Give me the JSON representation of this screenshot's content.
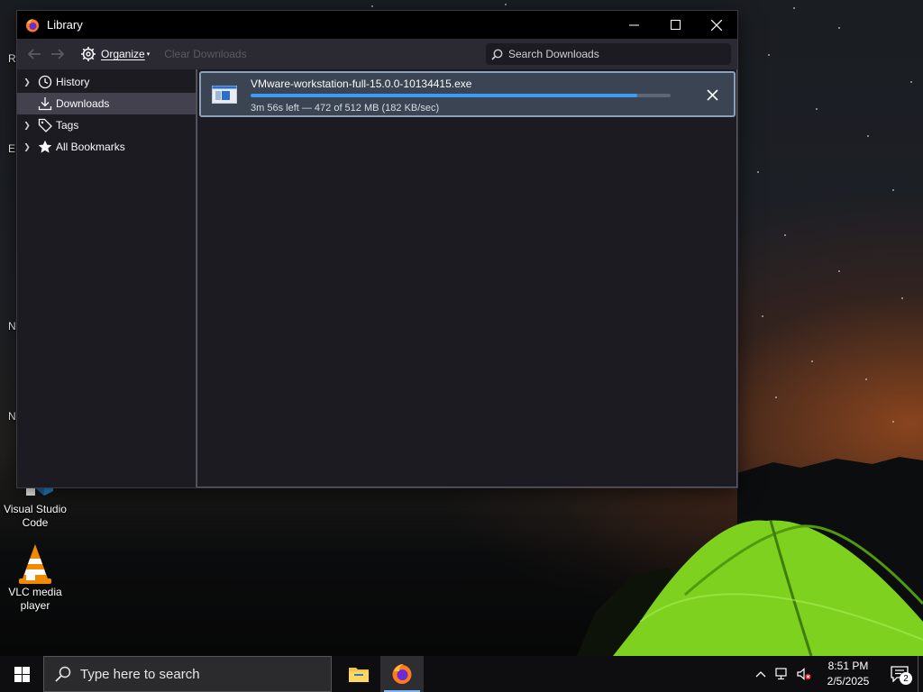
{
  "window": {
    "title": "Library",
    "buttons": {
      "minimize": "—",
      "maximize": "☐",
      "close": "✕"
    }
  },
  "toolbar": {
    "organize_label": "Organize",
    "clear_downloads_label": "Clear Downloads",
    "search_placeholder": "Search Downloads"
  },
  "sidebar": {
    "items": [
      {
        "label": "History",
        "icon": "clock-icon",
        "expandable": true,
        "selected": false
      },
      {
        "label": "Downloads",
        "icon": "download-icon",
        "expandable": false,
        "selected": true
      },
      {
        "label": "Tags",
        "icon": "tag-icon",
        "expandable": true,
        "selected": false
      },
      {
        "label": "All Bookmarks",
        "icon": "star-icon",
        "expandable": true,
        "selected": false
      }
    ]
  },
  "downloads": [
    {
      "filename": "VMware-workstation-full-15.0.0-10134415.exe",
      "status": "3m 56s left — 472 of 512 MB (182 KB/sec)",
      "progress_percent": 92
    }
  ],
  "desktop": {
    "icons": [
      {
        "label": "Visual Studio Code",
        "icon": "vscode-icon"
      },
      {
        "label": "VLC media player",
        "icon": "vlc-icon"
      }
    ],
    "edge_letters": [
      "R",
      "E",
      "N",
      "N"
    ]
  },
  "taskbar": {
    "search_placeholder": "Type here to search",
    "clock_time": "8:51 PM",
    "clock_date": "2/5/2025",
    "notification_count": "2"
  },
  "colors": {
    "accent": "#3d9df5",
    "window_bg": "#1c1b22",
    "toolbar_bg": "#2b2a33",
    "selected_bg": "#42414d",
    "download_item_bg": "#3a4452"
  }
}
